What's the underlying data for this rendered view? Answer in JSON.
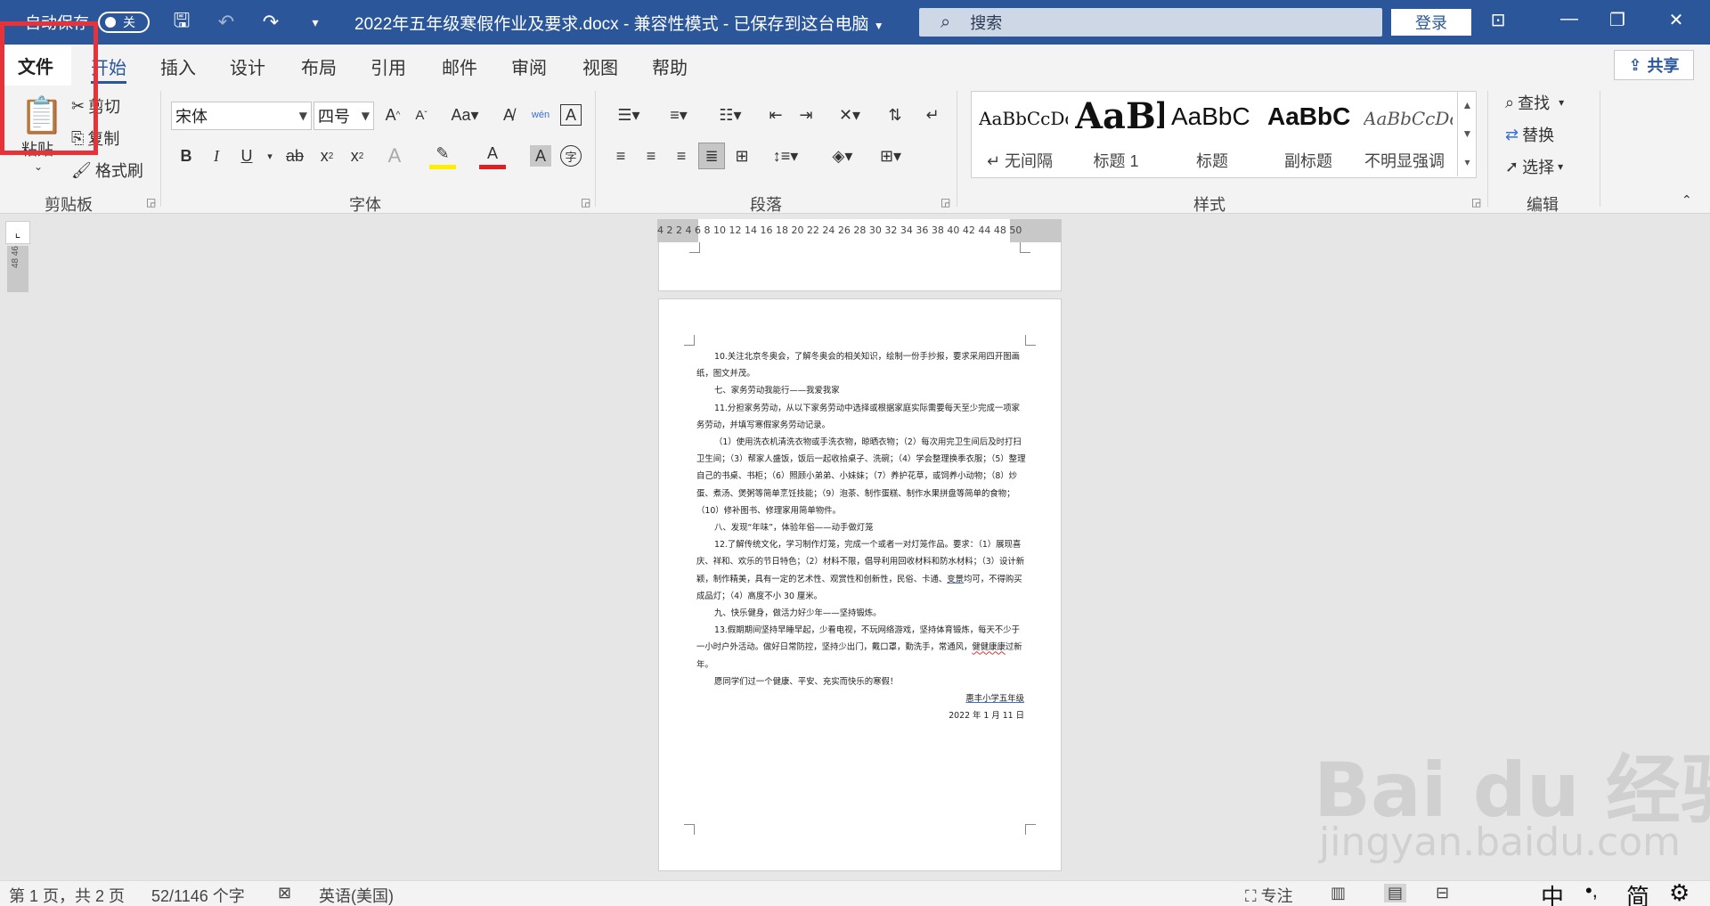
{
  "titlebar": {
    "autosave_label": "自动保存",
    "autosave_state": "关",
    "title": "2022年五年级寒假作业及要求.docx  -  兼容性模式  -  已保存到这台电脑",
    "search_placeholder": "搜索",
    "login_label": "登录"
  },
  "tabs": [
    {
      "label": "文件"
    },
    {
      "label": "开始"
    },
    {
      "label": "插入"
    },
    {
      "label": "设计"
    },
    {
      "label": "布局"
    },
    {
      "label": "引用"
    },
    {
      "label": "邮件"
    },
    {
      "label": "审阅"
    },
    {
      "label": "视图"
    },
    {
      "label": "帮助"
    }
  ],
  "share_label": "共享",
  "ribbon": {
    "clipboard": {
      "paste": "粘贴",
      "cut": "剪切",
      "copy": "复制",
      "format_painter": "格式刷",
      "group_label": "剪贴板"
    },
    "font": {
      "font_name": "宋体",
      "font_size": "四号",
      "group_label": "字体"
    },
    "paragraph": {
      "group_label": "段落"
    },
    "styles": {
      "items": [
        {
          "preview": "AaBbCcDc",
          "name": "↵ 无间隔"
        },
        {
          "preview": "AaBl",
          "name": "标题 1"
        },
        {
          "preview": "AaBbC",
          "name": "标题"
        },
        {
          "preview": "AaBbC",
          "name": "副标题"
        },
        {
          "preview": "AaBbCcDc",
          "name": "不明显强调"
        }
      ],
      "group_label": "样式"
    },
    "editing": {
      "find": "查找",
      "replace": "替换",
      "select": "选择",
      "group_label": "编辑"
    }
  },
  "ruler": {
    "horizontal": "4  2    2  4  6  8 10 12 14 16 18 20 22 24 26 28 30 32 34 36 38 40 42 44    48 50",
    "vertical": "48  46"
  },
  "document": {
    "paragraphs": [
      "10.关注北京冬奥会，了解冬奥会的相关知识，绘制一份手抄报，要求采用四开图画纸，图文并茂。",
      "七、家务劳动我能行——我爱我家",
      "11.分担家务劳动，从以下家务劳动中选择或根据家庭实际需要每天至少完成一项家务劳动，并填写寒假家务劳动记录。",
      "（1）使用洗衣机清洗衣物或手洗衣物，晾晒衣物；（2）每次用完卫生间后及时打扫卫生间；（3）帮家人盛饭，饭后一起收拾桌子、洗碗；（4）学会整理换季衣服；（5）整理自己的书桌、书柜；（6）照顾小弟弟、小妹妹；（7）养护花草，或饲养小动物；（8）炒蛋、煮汤、煲粥等简单烹饪技能；（9）泡茶、制作蛋糕、制作水果拼盘等简单的食物；（10）修补图书、修理家用简单物件。",
      "八、发现“年味”，体验年俗——动手做灯笼",
      "12.了解传统文化，学习制作灯笼，完成一个或者一对灯笼作品。要求：（1）展现喜庆、祥和、欢乐的节日特色；（2）材料不限，倡导利用回收材料和防水材料；（3）设计新颖，制作精美，具有一定的艺术性、观赏性和创新性，民俗、卡通、",
      "九、快乐健身，做活力好少年——坚持锻炼。",
      "13.假期期间坚持早睡早起，少看电视，不玩网络游戏，坚持体育锻炼，每天不少于一小时户外活动。做好日常防控，坚持少出门，戴口罩，勤洗手，常通风，",
      "愿同学们过一个健康、平安、充实而快乐的寒假！"
    ],
    "p6_underlined": "变景",
    "p6_tail": "均可，不得购买成品灯；（4）高度不小 30 厘米。",
    "p7_underlined": "做活力好",
    "p8_underlined": "健健康康",
    "p8_tail": "过新年。",
    "signature": "惠丰小学五年级",
    "date": "2022 年 1 月 11 日"
  },
  "statusbar": {
    "page": "第 1 页，共 2 页",
    "words": "52/1146 个字",
    "language": "英语(美国)",
    "focus": "专注"
  },
  "ime": {
    "mode": "中",
    "punct": "简"
  },
  "watermark": {
    "main": "Bai du 经验",
    "sub": "jingyan.baidu.com"
  }
}
